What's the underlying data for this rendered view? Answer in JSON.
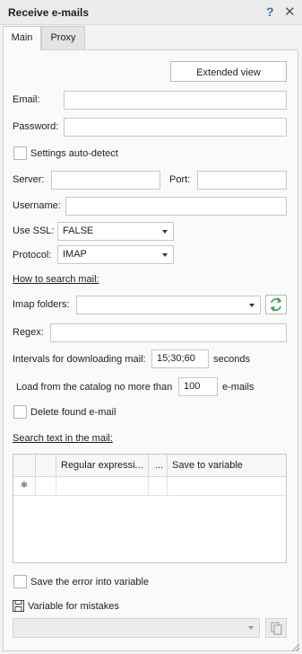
{
  "window": {
    "title": "Receive e-mails",
    "help_icon": "question-mark-icon",
    "close_icon": "close-icon"
  },
  "tabs": [
    {
      "label": "Main",
      "active": true
    },
    {
      "label": "Proxy",
      "active": false
    }
  ],
  "extended_view_label": "Extended view",
  "fields": {
    "email": {
      "label": "Email:",
      "value": ""
    },
    "password": {
      "label": "Password:",
      "value": ""
    },
    "autodetect": {
      "label": "Settings auto-detect",
      "checked": false
    },
    "server": {
      "label": "Server:",
      "value": ""
    },
    "port": {
      "label": "Port:",
      "value": ""
    },
    "username": {
      "label": "Username:",
      "value": ""
    },
    "use_ssl": {
      "label": "Use SSL:",
      "value": "FALSE"
    },
    "protocol": {
      "label": "Protocol:",
      "value": "IMAP"
    }
  },
  "search": {
    "heading": "How to search mail:",
    "imap_folders_label": "Imap folders:",
    "imap_folders_value": "",
    "regex_label": "Regex:",
    "regex_value": "",
    "intervals_label": "Intervals for downloading mail:",
    "intervals_value": "15;30;60",
    "intervals_unit": "seconds",
    "catalog_label": "Load from the catalog no more than",
    "catalog_value": "100",
    "catalog_unit": "e-mails",
    "delete_found_label": "Delete found e-mail",
    "delete_found_checked": false
  },
  "search_text": {
    "heading": "Search text in the mail:",
    "columns": [
      "",
      "",
      "Regular expressi...",
      "...",
      "Save to variable"
    ],
    "new_row_marker": "✱"
  },
  "errors": {
    "save_error_label": "Save the error into variable",
    "save_error_checked": false,
    "variable_label": "Variable for mistakes",
    "variable_icon": "floppy-disk-icon",
    "variable_value": "",
    "copy_icon": "copy-icon"
  },
  "colors": {
    "accent": "#3a6fb7",
    "refresh_icon": "#2e9e4f"
  }
}
